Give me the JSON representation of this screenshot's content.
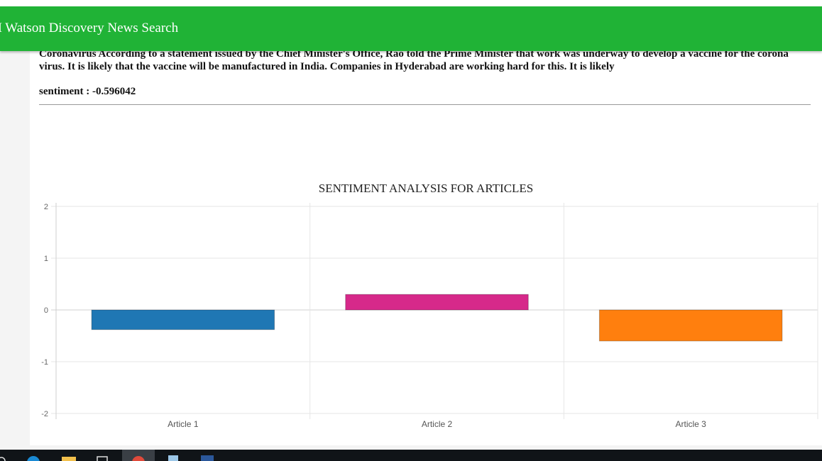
{
  "header": {
    "title": "M Watson Discovery News Search"
  },
  "article": {
    "text": "Coronavirus According to a statement issued by the Chief Minister's Office, Rao told the Prime Minister that work was underway to develop a vaccine for the corona virus. It is likely that the vaccine will be manufactured in India. Companies in Hyderabad are working hard for this. It is likely",
    "sentiment_label": "sentiment : -0.596042"
  },
  "chart_data": {
    "type": "bar",
    "title": "SENTIMENT ANALYSIS FOR ARTICLES",
    "categories": [
      "Article 1",
      "Article 2",
      "Article 3"
    ],
    "values": [
      -0.38,
      0.3,
      -0.6
    ],
    "colors": [
      "#1f77b4",
      "#d6298a",
      "#ff7f0e"
    ],
    "ylim": [
      -2,
      2
    ],
    "yticks": [
      2,
      1,
      0,
      -1,
      -2
    ],
    "grid": true
  },
  "colors": {
    "header": "#20b336",
    "taskbar": "#101418"
  },
  "taskbar": {
    "icons": [
      "search-icon",
      "edge-browser-icon",
      "file-explorer-icon",
      "store-icon",
      "chrome-icon",
      "notepad-icon",
      "word-icon"
    ]
  }
}
